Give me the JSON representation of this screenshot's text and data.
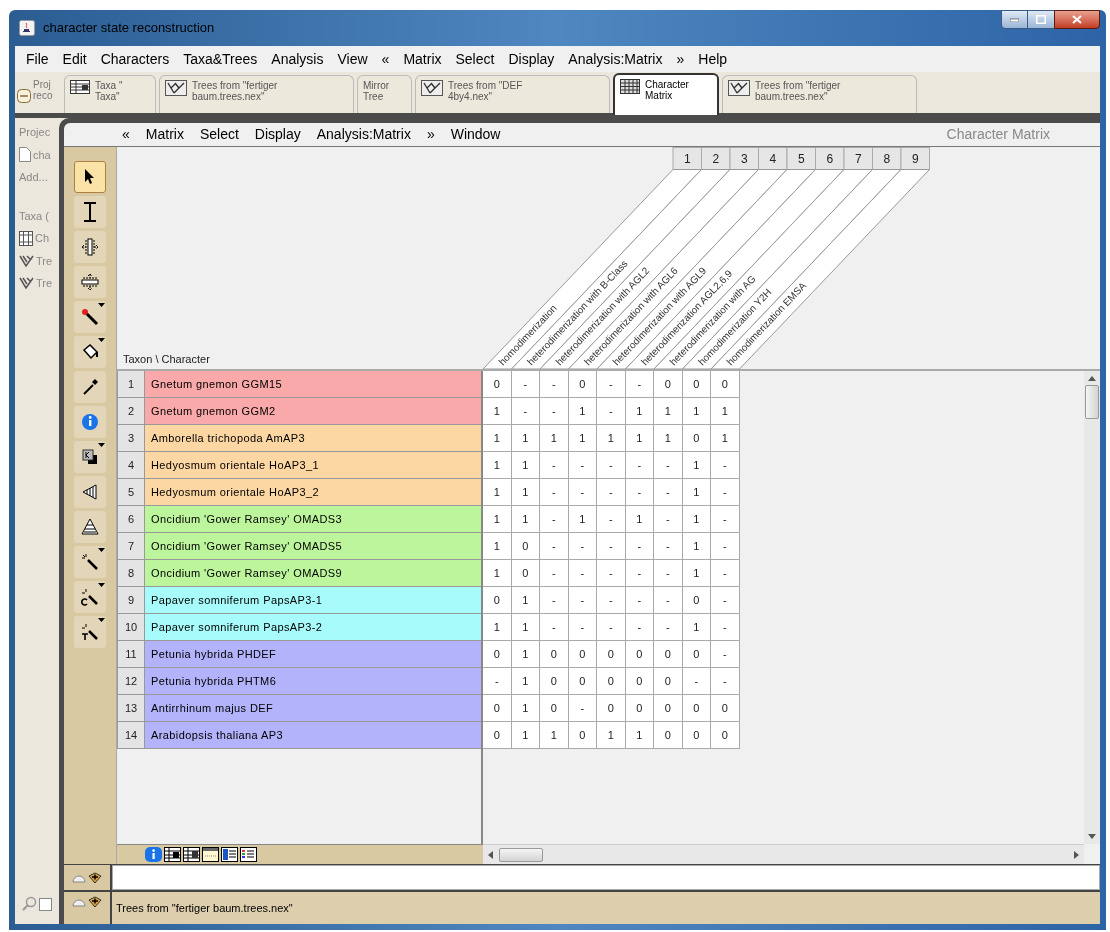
{
  "window": {
    "title": "character state reconstruction"
  },
  "menu": [
    "File",
    "Edit",
    "Characters",
    "Taxa&Trees",
    "Analysis",
    "View",
    "«",
    "Matrix",
    "Select",
    "Display",
    "Analysis:Matrix",
    "»",
    "Help"
  ],
  "tabs": [
    {
      "lines": [
        "Proj",
        "reco"
      ],
      "kind": "project",
      "selected": false
    },
    {
      "lines": [
        "Taxa \"",
        "Taxa\""
      ],
      "kind": "taxa",
      "selected": false
    },
    {
      "lines": [
        "Trees from \"fertiger",
        "baum.trees.nex\""
      ],
      "kind": "tree",
      "selected": false
    },
    {
      "lines": [
        "Mirror",
        "Tree"
      ],
      "kind": "plain",
      "selected": false
    },
    {
      "lines": [
        "Trees from \"DEF",
        "4by4.nex\""
      ],
      "kind": "tree",
      "selected": false
    },
    {
      "lines": [
        "Character",
        "Matrix"
      ],
      "kind": "matrix",
      "selected": true
    },
    {
      "lines": [
        "Trees from \"fertiger",
        "baum.trees.nex\""
      ],
      "kind": "tree",
      "selected": false
    }
  ],
  "project_panel": [
    {
      "label": "Projec",
      "kind": "heading"
    },
    {
      "label": "cha",
      "kind": "file"
    },
    {
      "label": "Add...",
      "kind": "plain"
    },
    {
      "label": "Taxa (",
      "kind": "heading"
    },
    {
      "label": "Ch",
      "kind": "matrix"
    },
    {
      "label": "Tre",
      "kind": "tree"
    },
    {
      "label": "Tre",
      "kind": "tree"
    }
  ],
  "inner_menu": [
    "«",
    "Matrix",
    "Select",
    "Display",
    "Analysis:Matrix",
    "»",
    "Window"
  ],
  "inner_title": "Character Matrix",
  "tools": [
    {
      "kind": "arrow",
      "selected": true,
      "menu": false
    },
    {
      "kind": "ibeam",
      "selected": false,
      "menu": false
    },
    {
      "kind": "colwidth",
      "selected": false,
      "menu": false
    },
    {
      "kind": "rowheight",
      "selected": false,
      "menu": false
    },
    {
      "kind": "brush",
      "selected": false,
      "menu": true
    },
    {
      "kind": "bucket",
      "selected": false,
      "menu": true
    },
    {
      "kind": "dropper",
      "selected": false,
      "menu": false
    },
    {
      "kind": "info",
      "selected": false,
      "menu": false
    },
    {
      "kind": "key",
      "selected": false,
      "menu": true
    },
    {
      "kind": "wedgeleft",
      "selected": false,
      "menu": false
    },
    {
      "kind": "wedgeup",
      "selected": false,
      "menu": false
    },
    {
      "kind": "wand",
      "selected": false,
      "menu": true
    },
    {
      "kind": "wandc",
      "selected": false,
      "menu": true
    },
    {
      "kind": "wandt",
      "selected": false,
      "menu": true
    }
  ],
  "matrix": {
    "corner_label": "Taxon \\ Character",
    "characters": [
      {
        "number": "1",
        "name": "homodimerization"
      },
      {
        "number": "2",
        "name": "heterodimerization with B-Class"
      },
      {
        "number": "3",
        "name": "heterodimerization with AGL2"
      },
      {
        "number": "4",
        "name": "heterodimerization with AGL6"
      },
      {
        "number": "5",
        "name": "heterodimerization with AGL9"
      },
      {
        "number": "6",
        "name": "heterodimerization AGL2,6,9"
      },
      {
        "number": "7",
        "name": "heterodimerization with AG"
      },
      {
        "number": "8",
        "name": "homodimerization Y2H"
      },
      {
        "number": "9",
        "name": "homodimerization EMSA"
      }
    ],
    "taxa": [
      {
        "number": "1",
        "name": "Gnetum gnemon GGM15",
        "color": "#f9a9a9",
        "states": [
          "0",
          "-",
          "-",
          "0",
          "-",
          "-",
          "0",
          "0",
          "0"
        ]
      },
      {
        "number": "2",
        "name": "Gnetum gnemon GGM2",
        "color": "#f9a9a9",
        "states": [
          "1",
          "-",
          "-",
          "1",
          "-",
          "1",
          "1",
          "1",
          "1"
        ]
      },
      {
        "number": "3",
        "name": "Amborella trichopoda AmAP3",
        "color": "#fdd7a3",
        "states": [
          "1",
          "1",
          "1",
          "1",
          "1",
          "1",
          "1",
          "0",
          "1"
        ]
      },
      {
        "number": "4",
        "name": "Hedyosmum orientale HoAP3_1",
        "color": "#fdd7a3",
        "states": [
          "1",
          "1",
          "-",
          "-",
          "-",
          "-",
          "-",
          "1",
          "-"
        ]
      },
      {
        "number": "5",
        "name": "Hedyosmum orientale HoAP3_2",
        "color": "#fdd7a3",
        "states": [
          "1",
          "1",
          "-",
          "-",
          "-",
          "-",
          "-",
          "1",
          "-"
        ]
      },
      {
        "number": "6",
        "name": "Oncidium 'Gower Ramsey' OMADS3",
        "color": "#bdf59d",
        "states": [
          "1",
          "1",
          "-",
          "1",
          "-",
          "1",
          "-",
          "1",
          "-"
        ]
      },
      {
        "number": "7",
        "name": "Oncidium 'Gower Ramsey' OMADS5",
        "color": "#bdf59d",
        "states": [
          "1",
          "0",
          "-",
          "-",
          "-",
          "-",
          "-",
          "1",
          "-"
        ]
      },
      {
        "number": "8",
        "name": "Oncidium 'Gower Ramsey' OMADS9",
        "color": "#bdf59d",
        "states": [
          "1",
          "0",
          "-",
          "-",
          "-",
          "-",
          "-",
          "1",
          "-"
        ]
      },
      {
        "number": "9",
        "name": "Papaver somniferum PapsAP3-1",
        "color": "#a8fbfb",
        "states": [
          "0",
          "1",
          "-",
          "-",
          "-",
          "-",
          "-",
          "0",
          "-"
        ]
      },
      {
        "number": "10",
        "name": "Papaver somniferum PapsAP3-2",
        "color": "#a8fbfb",
        "states": [
          "1",
          "1",
          "-",
          "-",
          "-",
          "-",
          "-",
          "1",
          "-"
        ]
      },
      {
        "number": "11",
        "name": "Petunia hybrida PHDEF",
        "color": "#b3b3fb",
        "states": [
          "0",
          "1",
          "0",
          "0",
          "0",
          "0",
          "0",
          "0",
          "-"
        ]
      },
      {
        "number": "12",
        "name": "Petunia hybrida PHTM6",
        "color": "#b3b3fb",
        "states": [
          "-",
          "1",
          "0",
          "0",
          "0",
          "0",
          "0",
          "-",
          "-"
        ]
      },
      {
        "number": "13",
        "name": "Antirrhinum majus DEF",
        "color": "#b3b3fb",
        "states": [
          "0",
          "1",
          "0",
          "-",
          "0",
          "0",
          "0",
          "0",
          "0"
        ]
      },
      {
        "number": "14",
        "name": "Arabidopsis thaliana AP3",
        "color": "#b3b3fb",
        "states": [
          "0",
          "1",
          "1",
          "0",
          "1",
          "1",
          "0",
          "0",
          "0"
        ]
      }
    ]
  },
  "search_checkbox": {
    "checked": false
  },
  "status": "Trees from \"fertiger baum.trees.nex\""
}
